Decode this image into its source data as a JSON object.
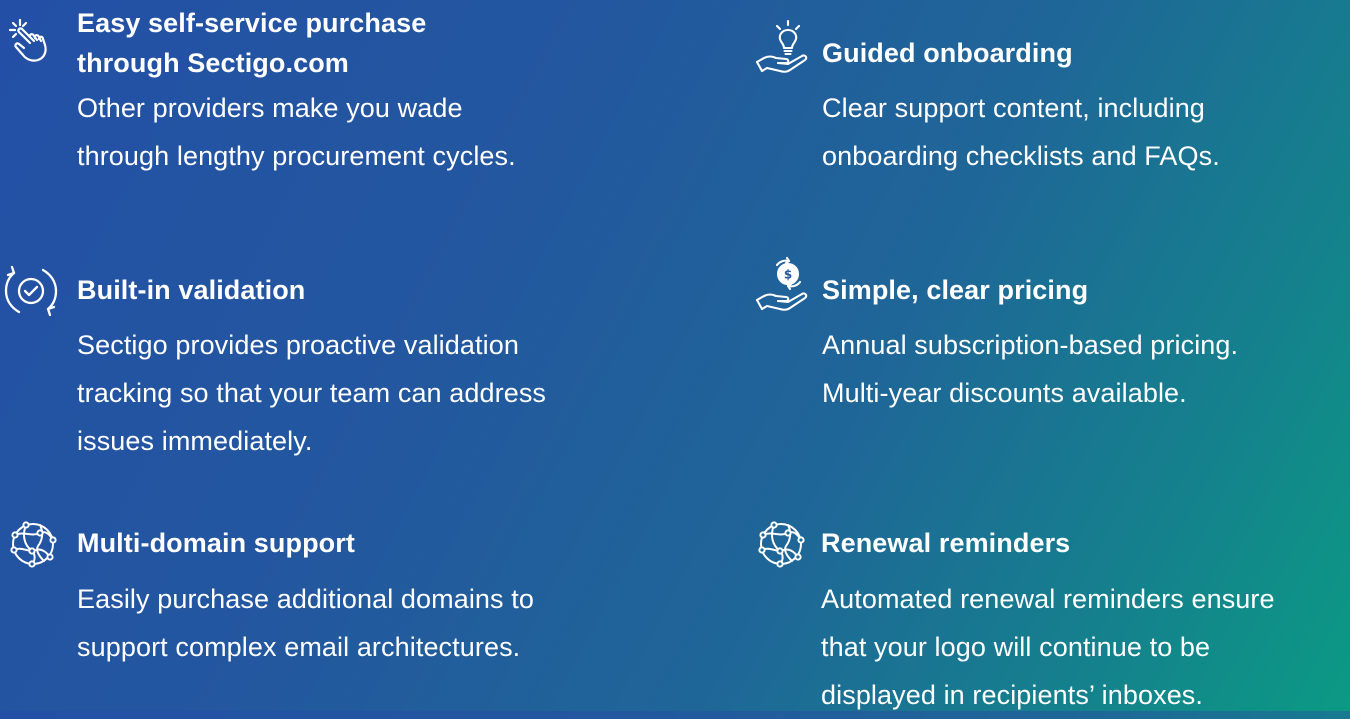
{
  "features": [
    {
      "id": "easy-purchase",
      "icon": "hand-pointer-icon",
      "title_lines": [
        "Easy self-service purchase",
        "through Sectigo.com"
      ],
      "desc_lines": [
        "Other providers make you wade",
        "through lengthy procurement cycles."
      ]
    },
    {
      "id": "guided-onboarding",
      "icon": "lightbulb-hand-icon",
      "title_lines": [
        "Guided onboarding"
      ],
      "desc_lines": [
        "Clear support content, including",
        "onboarding checklists and FAQs."
      ]
    },
    {
      "id": "built-in-validation",
      "icon": "refresh-check-icon",
      "title_lines": [
        "Built-in validation"
      ],
      "desc_lines": [
        "Sectigo provides proactive validation",
        "tracking so that your team can address",
        "issues immediately."
      ]
    },
    {
      "id": "simple-pricing",
      "icon": "coin-hand-icon",
      "title_lines": [
        "Simple, clear pricing"
      ],
      "desc_lines": [
        "Annual subscription-based pricing.",
        "Multi-year discounts available."
      ]
    },
    {
      "id": "multi-domain",
      "icon": "globe-network-icon",
      "title_lines": [
        "Multi-domain support"
      ],
      "desc_lines": [
        "Easily purchase additional domains to",
        "support complex email architectures."
      ]
    },
    {
      "id": "renewal-reminders",
      "icon": "globe-network-icon",
      "title_lines": [
        "Renewal reminders"
      ],
      "desc_lines": [
        "Automated renewal reminders ensure",
        "that your logo will continue to be",
        "displayed in recipients’ inboxes."
      ]
    }
  ]
}
